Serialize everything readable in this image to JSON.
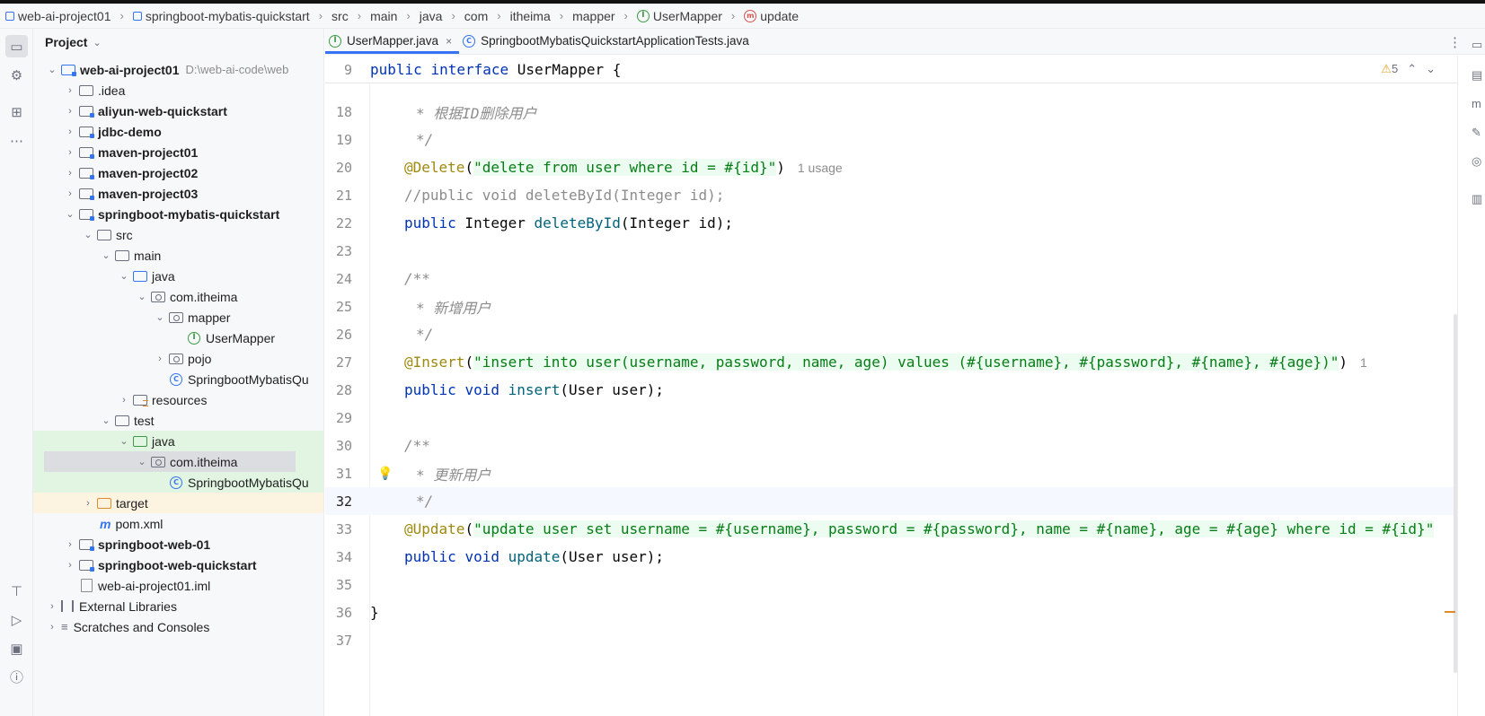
{
  "breadcrumb": [
    "web-ai-project01",
    "springboot-mybatis-quickstart",
    "src",
    "main",
    "java",
    "com",
    "itheima",
    "mapper",
    "UserMapper",
    "update"
  ],
  "project_panel": {
    "title": "Project",
    "tree": [
      {
        "label": "web-ai-project01",
        "path": "D:\\web-ai-code\\web"
      },
      {
        "label": ".idea"
      },
      {
        "label": "aliyun-web-quickstart"
      },
      {
        "label": "jdbc-demo"
      },
      {
        "label": "maven-project01"
      },
      {
        "label": "maven-project02"
      },
      {
        "label": "maven-project03"
      },
      {
        "label": "springboot-mybatis-quickstart"
      },
      {
        "label": "src"
      },
      {
        "label": "main"
      },
      {
        "label": "java"
      },
      {
        "label": "com.itheima"
      },
      {
        "label": "mapper"
      },
      {
        "label": "UserMapper"
      },
      {
        "label": "pojo"
      },
      {
        "label": "SpringbootMybatisQu"
      },
      {
        "label": "resources"
      },
      {
        "label": "test"
      },
      {
        "label": "java"
      },
      {
        "label": "com.itheima"
      },
      {
        "label": "SpringbootMybatisQu"
      },
      {
        "label": "target"
      },
      {
        "label": "pom.xml"
      },
      {
        "label": "springboot-web-01"
      },
      {
        "label": "springboot-web-quickstart"
      },
      {
        "label": "web-ai-project01.iml"
      },
      {
        "label": "External Libraries"
      },
      {
        "label": "Scratches and Consoles"
      }
    ]
  },
  "tabs": [
    {
      "label": "UserMapper.java",
      "close": "×"
    },
    {
      "label": "SpringbootMybatisQuickstartApplicationTests.java"
    }
  ],
  "editor": {
    "warnings": "5",
    "sticky_line": {
      "num": "9",
      "public": "public",
      "interface": "interface",
      "name": "UserMapper {"
    },
    "lines": {
      "l18": {
        "num": "18",
        "text": "* 根据ID删除用户"
      },
      "l19": {
        "num": "19",
        "text": "*/"
      },
      "l20": {
        "num": "20",
        "ann": "@Delete",
        "p1": "(",
        "str": "\"delete from user where id = #{id}\"",
        "p2": ")",
        "hint": "1 usage"
      },
      "l21": {
        "num": "21",
        "text": "//public void deleteById(Integer id);"
      },
      "l22": {
        "num": "22",
        "kw": "public",
        "t1": " Integer ",
        "m": "deleteById",
        "t2": "(Integer id);"
      },
      "l23": {
        "num": "23"
      },
      "l24": {
        "num": "24",
        "text": "/**"
      },
      "l25": {
        "num": "25",
        "text": "* 新增用户"
      },
      "l26": {
        "num": "26",
        "text": "*/"
      },
      "l27": {
        "num": "27",
        "ann": "@Insert",
        "p1": "(",
        "str": "\"insert into user(username, password, name, age) values (#{username}, #{password}, #{name}, #{age})\"",
        "p2": ")",
        "hint": "1"
      },
      "l28": {
        "num": "28",
        "kw1": "public",
        "kw2": "void",
        "m": "insert",
        "t2": "(User user);"
      },
      "l29": {
        "num": "29"
      },
      "l30": {
        "num": "30",
        "text": "/**"
      },
      "l31": {
        "num": "31",
        "text": "* 更新用户"
      },
      "l32": {
        "num": "32",
        "text": "*/"
      },
      "l33": {
        "num": "33",
        "ann": "@Update",
        "p1": "(",
        "str": "\"update user set username = #{username}, password = #{password}, name = #{name}, age = #{age} where id = #{id}\""
      },
      "l34": {
        "num": "34",
        "kw1": "public",
        "kw2": "void",
        "m": "update",
        "t2": "(User user);"
      },
      "l35": {
        "num": "35"
      },
      "l36": {
        "num": "36",
        "text": "}"
      },
      "l37": {
        "num": "37"
      }
    }
  }
}
